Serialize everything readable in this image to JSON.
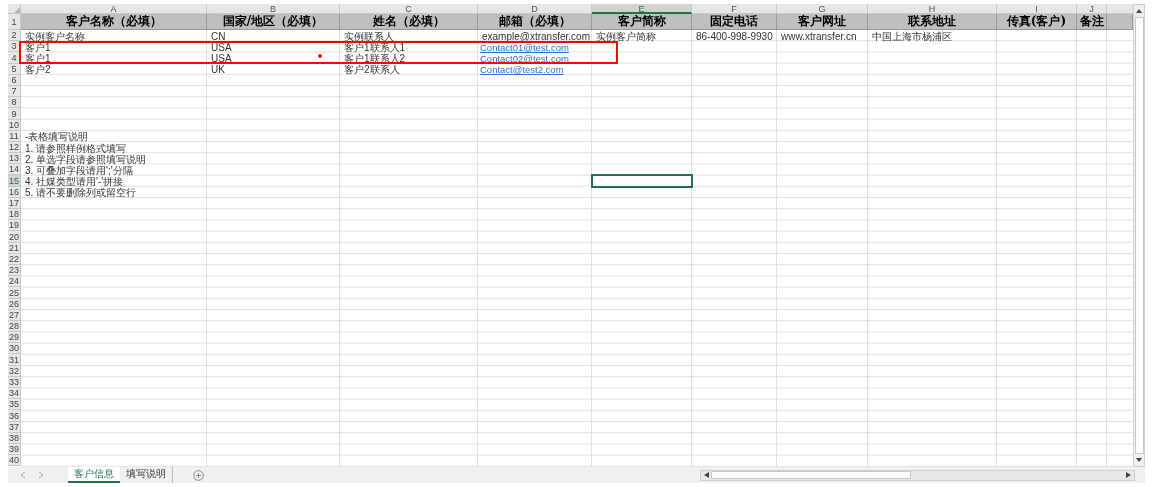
{
  "columns": [
    {
      "letter": "A",
      "selected": false
    },
    {
      "letter": "B",
      "selected": false
    },
    {
      "letter": "C",
      "selected": false
    },
    {
      "letter": "D",
      "selected": false
    },
    {
      "letter": "E",
      "selected": true
    },
    {
      "letter": "F",
      "selected": false
    },
    {
      "letter": "G",
      "selected": false
    },
    {
      "letter": "H",
      "selected": false
    },
    {
      "letter": "I",
      "selected": false
    },
    {
      "letter": "J",
      "selected": false
    }
  ],
  "rows": [
    {
      "number": "1",
      "selected": false,
      "kind": "header",
      "cells": {
        "A": "客户名称（必填）",
        "B": "国家/地区（必填）",
        "C": "姓名（必填）",
        "D": "邮箱（必填）",
        "E": "客户简称",
        "F": "固定电话",
        "G": "客户网址",
        "H": "联系地址",
        "I": "传真(客户)",
        "J": "备注"
      }
    },
    {
      "number": "2",
      "selected": false,
      "kind": "data",
      "cells": {
        "A": "实例客户名称",
        "B": "CN",
        "C": "实例联系人",
        "D": "example@xtransfer.com",
        "E": "实例客户简称",
        "F": "86-400-998-9930",
        "G": "www.xtransfer.cn",
        "H": "中国上海市杨浦区"
      }
    },
    {
      "number": "3",
      "selected": false,
      "kind": "data",
      "cells": {
        "A": "客户1",
        "B": "USA",
        "C": "客户1联系人1"
      },
      "links": {
        "D": "Contact01@test.com"
      }
    },
    {
      "number": "4",
      "selected": false,
      "kind": "data",
      "cells": {
        "A": "客户1",
        "B": "USA",
        "C": "客户1联系人2"
      },
      "links": {
        "D": "Contact02@test.com"
      }
    },
    {
      "number": "5",
      "selected": false,
      "kind": "data",
      "cells": {
        "A": "客户2",
        "B": "UK",
        "C": "客户2联系人"
      },
      "links": {
        "D": "Contact@test2.com"
      }
    },
    {
      "number": "6",
      "selected": false,
      "kind": "data"
    },
    {
      "number": "7",
      "selected": false,
      "kind": "data"
    },
    {
      "number": "8",
      "selected": false,
      "kind": "data"
    },
    {
      "number": "9",
      "selected": false,
      "kind": "data"
    },
    {
      "number": "10",
      "selected": false,
      "kind": "data"
    },
    {
      "number": "11",
      "selected": false,
      "kind": "data",
      "cells": {
        "A": "-表格填写说明"
      }
    },
    {
      "number": "12",
      "selected": false,
      "kind": "data",
      "cells": {
        "A": "1. 请参照样例格式填写"
      }
    },
    {
      "number": "13",
      "selected": false,
      "kind": "data",
      "cells": {
        "A": "2. 单选字段请参照填写说明"
      }
    },
    {
      "number": "14",
      "selected": false,
      "kind": "data",
      "cells": {
        "A": "3. 可叠加字段请用';'分隔"
      }
    },
    {
      "number": "15",
      "selected": true,
      "kind": "data",
      "cells": {
        "A": "4. 社媒类型请用'-'拼接"
      }
    },
    {
      "number": "16",
      "selected": false,
      "kind": "data",
      "cells": {
        "A": "5. 请不要删除列或留空行"
      }
    },
    {
      "number": "17",
      "selected": false,
      "kind": "data"
    },
    {
      "number": "18",
      "selected": false,
      "kind": "data"
    },
    {
      "number": "19",
      "selected": false,
      "kind": "data"
    },
    {
      "number": "20",
      "selected": false,
      "kind": "data"
    },
    {
      "number": "21",
      "selected": false,
      "kind": "data"
    },
    {
      "number": "22",
      "selected": false,
      "kind": "data"
    },
    {
      "number": "23",
      "selected": false,
      "kind": "data"
    },
    {
      "number": "24",
      "selected": false,
      "kind": "data"
    },
    {
      "number": "25",
      "selected": false,
      "kind": "data"
    },
    {
      "number": "26",
      "selected": false,
      "kind": "data"
    },
    {
      "number": "27",
      "selected": false,
      "kind": "data"
    },
    {
      "number": "28",
      "selected": false,
      "kind": "data"
    },
    {
      "number": "29",
      "selected": false,
      "kind": "data"
    },
    {
      "number": "30",
      "selected": false,
      "kind": "data"
    },
    {
      "number": "31",
      "selected": false,
      "kind": "data"
    },
    {
      "number": "32",
      "selected": false,
      "kind": "data"
    },
    {
      "number": "33",
      "selected": false,
      "kind": "data"
    },
    {
      "number": "34",
      "selected": false,
      "kind": "data"
    },
    {
      "number": "35",
      "selected": false,
      "kind": "data"
    },
    {
      "number": "36",
      "selected": false,
      "kind": "data"
    },
    {
      "number": "37",
      "selected": false,
      "kind": "data"
    },
    {
      "number": "38",
      "selected": false,
      "kind": "data"
    },
    {
      "number": "39",
      "selected": false,
      "kind": "data"
    },
    {
      "number": "40",
      "selected": false,
      "kind": "data"
    }
  ],
  "sheet_tabs": [
    {
      "label": "客户信息",
      "selected": true
    },
    {
      "label": "填写说明",
      "selected": false
    }
  ]
}
